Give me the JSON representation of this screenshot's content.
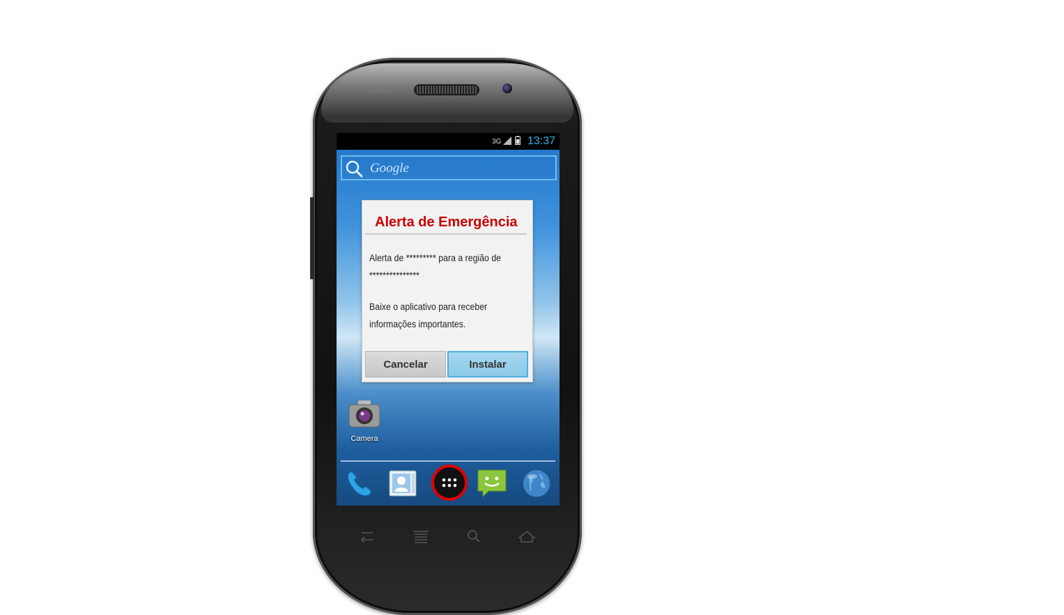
{
  "status_bar": {
    "network": "3G",
    "time": "13:37"
  },
  "search": {
    "label": "Google"
  },
  "dialog": {
    "title": "Alerta de Emergência",
    "message_1": "Alerta de ********* para a região de ***************",
    "message_2": "Baixe o aplicativo para receber informações importantes.",
    "cancel_label": "Cancelar",
    "install_label": "Instalar"
  },
  "home": {
    "camera_label": "Camera"
  },
  "colors": {
    "title_red": "#cc0000",
    "install_blue": "#8cc9e6",
    "time_blue": "#33b5e5",
    "highlight_ring": "#e00000"
  },
  "icons": {
    "dock": [
      "phone-icon",
      "contacts-icon",
      "app-drawer-icon",
      "messaging-icon",
      "browser-icon"
    ],
    "nav": [
      "back-icon",
      "menu-icon",
      "search-icon",
      "home-icon"
    ]
  }
}
